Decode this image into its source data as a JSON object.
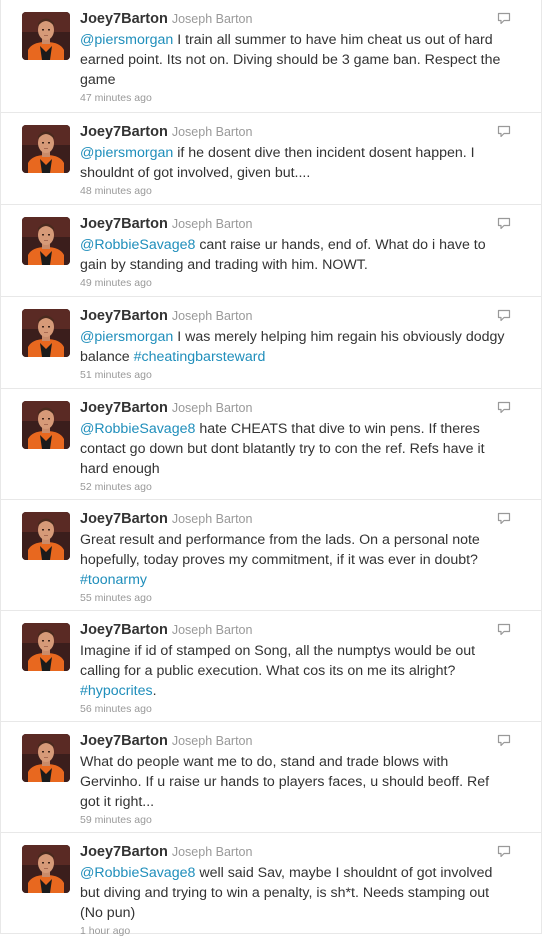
{
  "colors": {
    "link": "#1f8ebb",
    "text": "#333333",
    "muted": "#999999",
    "divider": "#e8e8e8"
  },
  "icons": {
    "reply": "speech-bubble-icon",
    "avatar": "profile-photo"
  },
  "tweets": [
    {
      "screen_name": "Joey7Barton",
      "full_name": "Joseph Barton",
      "segments": [
        {
          "type": "mention",
          "text": "@piersmorgan"
        },
        {
          "type": "text",
          "text": " I train all summer to have him cheat us out of hard earned point. Its not on. Diving should be 3 game ban. Respect the game"
        }
      ],
      "time": "47 minutes ago"
    },
    {
      "screen_name": "Joey7Barton",
      "full_name": "Joseph Barton",
      "segments": [
        {
          "type": "mention",
          "text": "@piersmorgan"
        },
        {
          "type": "text",
          "text": " if he dosent dive then incident dosent happen. I shouldnt of got involved, given but...."
        }
      ],
      "time": "48 minutes ago"
    },
    {
      "screen_name": "Joey7Barton",
      "full_name": "Joseph Barton",
      "segments": [
        {
          "type": "mention",
          "text": "@RobbieSavage8"
        },
        {
          "type": "text",
          "text": " cant raise ur hands, end of. What do i have to gain by standing and trading with him. NOWT."
        }
      ],
      "time": "49 minutes ago"
    },
    {
      "screen_name": "Joey7Barton",
      "full_name": "Joseph Barton",
      "segments": [
        {
          "type": "mention",
          "text": "@piersmorgan"
        },
        {
          "type": "text",
          "text": " I was merely helping him regain his obviously dodgy balance "
        },
        {
          "type": "hashtag",
          "text": "#cheatingbarsteward"
        }
      ],
      "time": "51 minutes ago"
    },
    {
      "screen_name": "Joey7Barton",
      "full_name": "Joseph Barton",
      "segments": [
        {
          "type": "mention",
          "text": "@RobbieSavage8"
        },
        {
          "type": "text",
          "text": " hate CHEATS that dive to win pens. If theres contact go down but dont blatantly try to con the ref. Refs have it hard enough"
        }
      ],
      "time": "52 minutes ago"
    },
    {
      "screen_name": "Joey7Barton",
      "full_name": "Joseph Barton",
      "segments": [
        {
          "type": "text",
          "text": "Great result and performance from the lads. On a personal note hopefully, today proves my commitment, if it was ever in doubt? "
        },
        {
          "type": "hashtag",
          "text": "#toonarmy"
        }
      ],
      "time": "55 minutes ago"
    },
    {
      "screen_name": "Joey7Barton",
      "full_name": "Joseph Barton",
      "segments": [
        {
          "type": "text",
          "text": "Imagine if id of stamped on Song, all the numptys would be out calling for a public execution. What cos its on me its alright? "
        },
        {
          "type": "hashtag",
          "text": "#hypocrites"
        },
        {
          "type": "text",
          "text": "."
        }
      ],
      "time": "56 minutes ago"
    },
    {
      "screen_name": "Joey7Barton",
      "full_name": "Joseph Barton",
      "segments": [
        {
          "type": "text",
          "text": "What do people want me to do, stand and trade blows with Gervinho. If u raise ur hands to players faces, u should beoff. Ref got it right..."
        }
      ],
      "time": "59 minutes ago"
    },
    {
      "screen_name": "Joey7Barton",
      "full_name": "Joseph Barton",
      "segments": [
        {
          "type": "mention",
          "text": "@RobbieSavage8"
        },
        {
          "type": "text",
          "text": " well said Sav, maybe I shouldnt of got involved but diving and trying to win a penalty, is sh*t. Needs stamping out (No pun)"
        }
      ],
      "time": "1 hour ago"
    }
  ]
}
